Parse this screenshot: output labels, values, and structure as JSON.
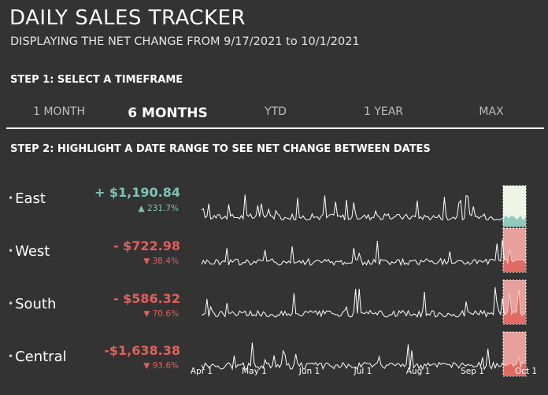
{
  "header": {
    "title": "DAILY SALES TRACKER",
    "subtitle": "DISPLAYING THE NET CHANGE FROM 9/17/2021 to 10/1/2021"
  },
  "step1": {
    "label": "STEP 1: SELECT A TIMEFRAME"
  },
  "tabs": [
    {
      "label": "1 MONTH",
      "active": false
    },
    {
      "label": "6 MONTHS",
      "active": true
    },
    {
      "label": "YTD",
      "active": false
    },
    {
      "label": "1 YEAR",
      "active": false
    },
    {
      "label": "MAX",
      "active": false
    }
  ],
  "step2": {
    "label": "STEP 2: HIGHLIGHT A DATE RANGE TO SEE NET CHANGE BETWEEN DATES"
  },
  "regions": [
    {
      "name": "East",
      "change": "+ $1,190.84",
      "pct": "▲ 231.7%",
      "direction": "up"
    },
    {
      "name": "West",
      "change": "- $722.98",
      "pct": "▼ 38.4%",
      "direction": "down"
    },
    {
      "name": "South",
      "change": "- $586.32",
      "pct": "▼ 70.6%",
      "direction": "down"
    },
    {
      "name": "Central",
      "change": "-$1,638.38",
      "pct": "▼ 93.6%",
      "direction": "down"
    }
  ],
  "colors": {
    "background": "#333333",
    "positive": "#7cc3b5",
    "negative": "#e0605a",
    "highlight_positive": "#eef5e4",
    "highlight_negative": "#e8a09a",
    "line": "#ffffff"
  },
  "chart_data": {
    "type": "line",
    "x_labels": [
      "Apr 1",
      "May 1",
      "Jun 1",
      "Jul 1",
      "Aug 1",
      "Sep 1",
      "Oct 1"
    ],
    "x_range": [
      "2021-04-01",
      "2021-10-01"
    ],
    "highlight_range": [
      "2021-09-17",
      "2021-10-01"
    ],
    "series": [
      {
        "name": "East",
        "ylim": [
          0,
          1000
        ],
        "highlight_color": "#eef5e4",
        "area_color": "#7cc3b5"
      },
      {
        "name": "West",
        "ylim": [
          0,
          1000
        ],
        "highlight_color": "#e8a09a",
        "area_color": "#e0605a"
      },
      {
        "name": "South",
        "ylim": [
          0,
          1000
        ],
        "highlight_color": "#e8a09a",
        "area_color": "#e0605a"
      },
      {
        "name": "Central",
        "ylim": [
          0,
          1000
        ],
        "highlight_color": "#e8a09a",
        "area_color": "#e0605a"
      }
    ]
  }
}
